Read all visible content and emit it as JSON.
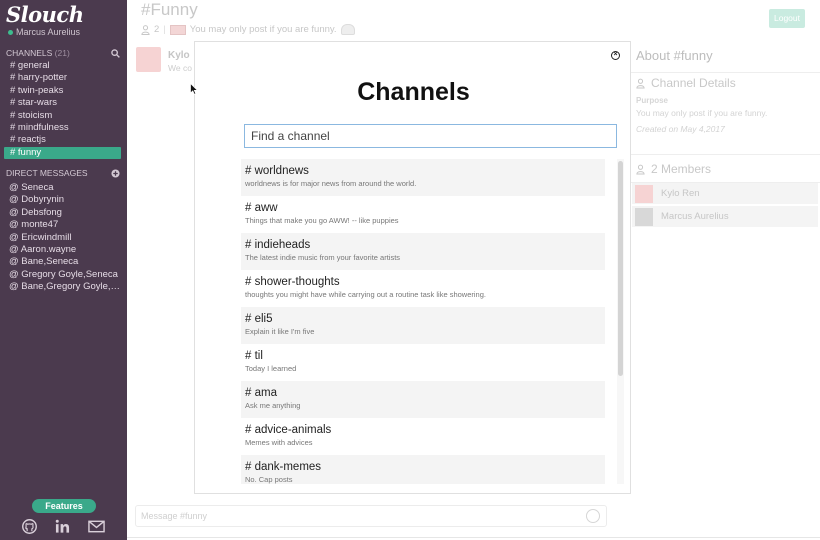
{
  "app": {
    "logo": "Slouch",
    "user": "Marcus Aurelius"
  },
  "sidebar": {
    "channels_label": "CHANNELS",
    "channels_count": "(21)",
    "channels": [
      {
        "label": "# general"
      },
      {
        "label": "# harry-potter"
      },
      {
        "label": "# twin-peaks"
      },
      {
        "label": "# star-wars"
      },
      {
        "label": "# stoicism"
      },
      {
        "label": "# mindfulness"
      },
      {
        "label": "# reactjs"
      },
      {
        "label": "# funny",
        "active": true
      }
    ],
    "dm_label": "DIRECT MESSAGES",
    "dms": [
      {
        "label": "@ Seneca"
      },
      {
        "label": "@ Dobyrynin"
      },
      {
        "label": "@ Debsfong"
      },
      {
        "label": "@ monte47"
      },
      {
        "label": "@ Ericwindmill"
      },
      {
        "label": "@ Aaron.wayne"
      },
      {
        "label": "@ Bane,Seneca"
      },
      {
        "label": "@ Gregory Goyle,Seneca"
      },
      {
        "label": "@ Bane,Gregory Goyle,MIK..."
      }
    ],
    "features_label": "Features"
  },
  "main": {
    "title": "#Funny",
    "member_count": "2",
    "purpose": "You may only post if you are funny.",
    "logout_label": "Logout",
    "message_author": "Kylo",
    "message_text": "We co",
    "input_placeholder": "Message #funny"
  },
  "right_panel": {
    "title": "About #funny",
    "details_heading": "Channel Details",
    "purpose_label": "Purpose",
    "purpose_text": "You may only post if you are funny.",
    "created_text": "Created on May 4,2017",
    "members_heading": "2 Members",
    "members": [
      {
        "name": "Kylo Ren"
      },
      {
        "name": "Marcus Aurelius"
      }
    ]
  },
  "modal": {
    "title": "Channels",
    "search_placeholder": "Find a channel",
    "channels": [
      {
        "name": "# worldnews",
        "desc": "worldnews is for major news from around the world."
      },
      {
        "name": "# aww",
        "desc": "Things that make you go AWW! -- like puppies"
      },
      {
        "name": "# indieheads",
        "desc": "The latest indie music from your favorite artists"
      },
      {
        "name": "# shower-thoughts",
        "desc": "thoughts you might have while carrying out a routine task like showering."
      },
      {
        "name": "# eli5",
        "desc": "Explain it like I'm five"
      },
      {
        "name": "# til",
        "desc": "Today I learned"
      },
      {
        "name": "# ama",
        "desc": "Ask me anything"
      },
      {
        "name": "# advice-animals",
        "desc": "Memes with advices"
      },
      {
        "name": "# dank-memes",
        "desc": "No. Cap posts"
      }
    ]
  },
  "colors": {
    "sidebar": "#4b3a4e",
    "accent": "#3aa98a"
  }
}
